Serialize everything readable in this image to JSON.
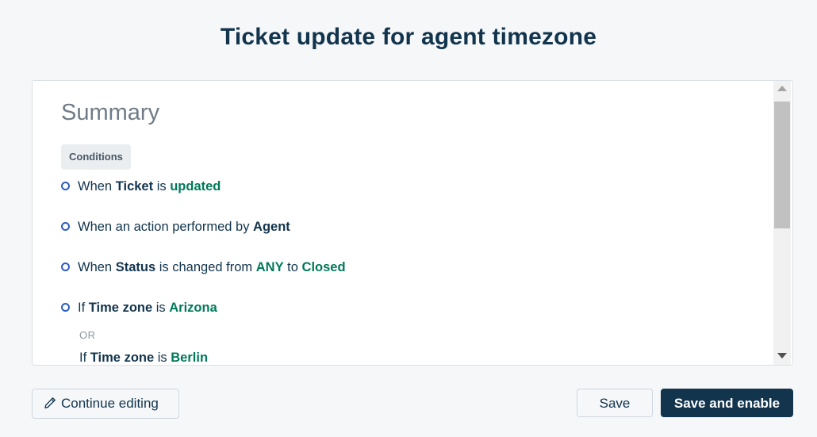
{
  "header": {
    "title": "Ticket update for agent timezone"
  },
  "summary": {
    "heading": "Summary",
    "conditions_label": "Conditions",
    "conditions": [
      {
        "prefix": "When",
        "key": "Ticket",
        "middle": "is",
        "value": "updated"
      },
      {
        "prefix": "When an action performed by",
        "key": "Agent"
      },
      {
        "prefix": "When",
        "key": "Status",
        "middle": "is changed from",
        "value": "ANY",
        "middle2": "to",
        "value2": "Closed"
      },
      {
        "prefix": "If",
        "key": "Time zone",
        "middle": "is",
        "value": "Arizona"
      }
    ],
    "or_label": "OR",
    "sub_condition": {
      "prefix": "If",
      "key": "Time zone",
      "middle": "is",
      "value": "Berlin"
    }
  },
  "footer": {
    "continue_label": "Continue editing",
    "save_label": "Save",
    "save_enable_label": "Save and enable"
  },
  "icons": {
    "bullet": "circle-bullet-icon",
    "pencil": "pencil-icon",
    "scroll_up": "scroll-up-arrow-icon",
    "scroll_down": "scroll-down-arrow-icon"
  },
  "colors": {
    "background": "#f5f7f9",
    "title": "#12344d",
    "value_green": "#00795b",
    "bullet_blue": "#2c5cc5",
    "primary_button": "#12344d"
  }
}
